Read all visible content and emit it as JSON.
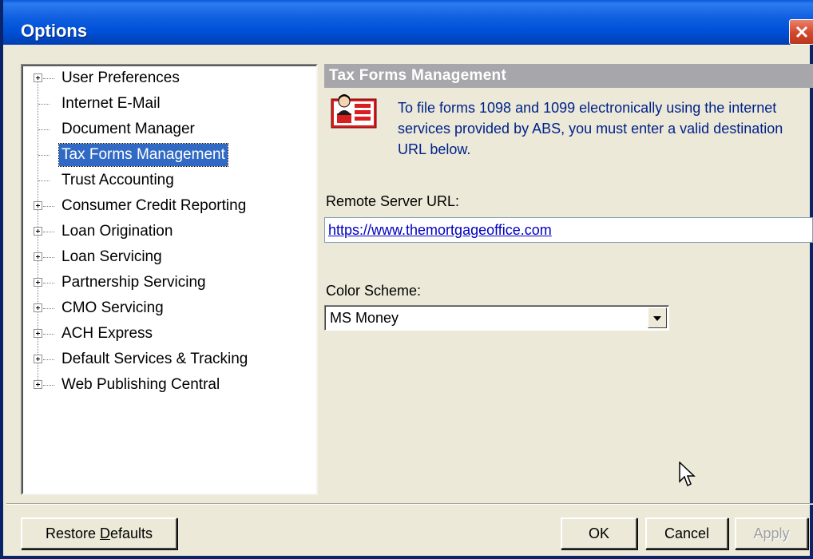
{
  "window": {
    "title": "Options"
  },
  "tree": {
    "items": [
      {
        "label": "User Preferences",
        "expandable": true
      },
      {
        "label": "Internet E-Mail",
        "expandable": false
      },
      {
        "label": "Document Manager",
        "expandable": false
      },
      {
        "label": "Tax Forms Management",
        "expandable": false,
        "selected": true
      },
      {
        "label": "Trust Accounting",
        "expandable": false
      },
      {
        "label": "Consumer Credit Reporting",
        "expandable": true
      },
      {
        "label": "Loan Origination",
        "expandable": true
      },
      {
        "label": "Loan Servicing",
        "expandable": true
      },
      {
        "label": "Partnership Servicing",
        "expandable": true
      },
      {
        "label": "CMO Servicing",
        "expandable": true
      },
      {
        "label": "ACH Express",
        "expandable": true
      },
      {
        "label": "Default Services & Tracking",
        "expandable": true
      },
      {
        "label": "Web Publishing Central",
        "expandable": true
      }
    ]
  },
  "panel": {
    "header": "Tax Forms Management",
    "info_icon": "tax-form-icon",
    "info_text": "To file forms 1098 and 1099 electronically using the internet services provided by ABS, you must enter a valid destination URL below.",
    "url_label": "Remote Server URL:",
    "url_value": "https://www.themortgageoffice.com",
    "color_label": "Color Scheme:",
    "color_value": "MS Money"
  },
  "buttons": {
    "restore_prefix": "Restore ",
    "restore_mnemonic": "D",
    "restore_suffix": "efaults",
    "ok": "OK",
    "cancel": "Cancel",
    "apply": "Apply"
  },
  "colors": {
    "title_bar": "#0050d8",
    "selection": "#316ac5",
    "header_bg": "#a7a6aa",
    "info_text": "#00228a"
  }
}
